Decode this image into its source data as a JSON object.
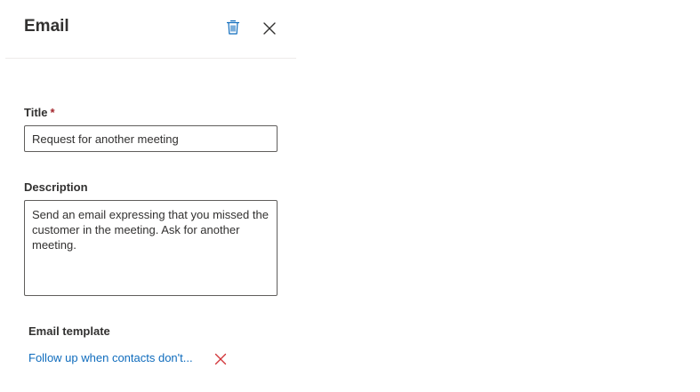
{
  "panel": {
    "title": "Email",
    "delete_icon": "trash-icon",
    "close_icon": "close-icon"
  },
  "form": {
    "title_label": "Title",
    "required_marker": "*",
    "title_value": "Request for another meeting",
    "description_label": "Description",
    "description_value": "Send an email expressing that you missed the customer in the meeting. Ask for another meeting.",
    "template_label": "Email template",
    "template_link": "Follow up when contacts don't...",
    "remove_icon": "remove-x-icon"
  },
  "colors": {
    "accent": "#0f6cbd",
    "required": "#a4262c",
    "remove": "#d13438"
  }
}
